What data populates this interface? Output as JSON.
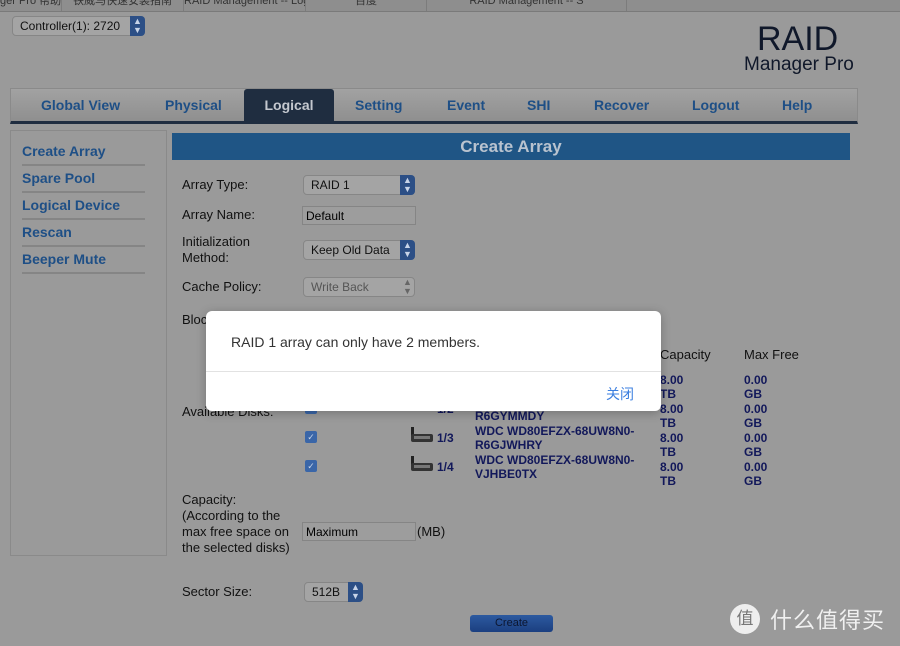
{
  "browser_tabs": [
    "ger Pro 帮助",
    "铁威马快速安装指南",
    "RAID Management -- Logical",
    "百度",
    "RAID Management -- S"
  ],
  "controller": "Controller(1): 2720",
  "logo": {
    "line1": "RAID",
    "line2": "Manager Pro"
  },
  "nav": [
    {
      "label": "Global View"
    },
    {
      "label": "Physical"
    },
    {
      "label": "Logical",
      "active": true
    },
    {
      "label": "Setting"
    },
    {
      "label": "Event"
    },
    {
      "label": "SHI"
    },
    {
      "label": "Recover"
    },
    {
      "label": "Logout"
    },
    {
      "label": "Help"
    }
  ],
  "sidebar": [
    "Create Array",
    "Spare Pool",
    "Logical Device",
    "Rescan",
    "Beeper Mute"
  ],
  "form": {
    "title": "Create Array",
    "array_type_label": "Array Type:",
    "array_type": "RAID 1",
    "array_name_label": "Array Name:",
    "array_name": "Default",
    "init_label": "Initialization Method:",
    "init": "Keep Old Data",
    "cache_label": "Cache Policy:",
    "cache": "Write Back",
    "block_label": "Bloc",
    "available_label": "Available Disks:",
    "col_capacity": "Capacity",
    "col_maxfree": "Max Free",
    "disks": [
      {
        "checked": true,
        "port": "",
        "model": "",
        "capacity": "8.00 TB",
        "max_free": "0.00 GB"
      },
      {
        "checked": true,
        "port": "1/2",
        "model": "R6GYMMDY",
        "capacity": "8.00 TB",
        "max_free": "0.00 GB"
      },
      {
        "checked": true,
        "port": "1/3",
        "model": "WDC WD80EFZX-68UW8N0-R6GJWHRY",
        "capacity": "8.00 TB",
        "max_free": "0.00 GB"
      },
      {
        "checked": true,
        "port": "1/4",
        "model": "WDC WD80EFZX-68UW8N0-VJHBE0TX",
        "capacity": "8.00 TB",
        "max_free": "0.00 GB"
      }
    ],
    "capacity_label": "Capacity: (According to the max free space on the selected disks)",
    "capacity_value": "Maximum",
    "capacity_unit": "(MB)",
    "sector_label": "Sector Size:",
    "sector": "512B",
    "create_label": "Create"
  },
  "dialog": {
    "message": "RAID 1 array can only have 2 members.",
    "close_label": "关闭"
  },
  "watermark": {
    "badge": "值",
    "text": "什么值得买"
  }
}
